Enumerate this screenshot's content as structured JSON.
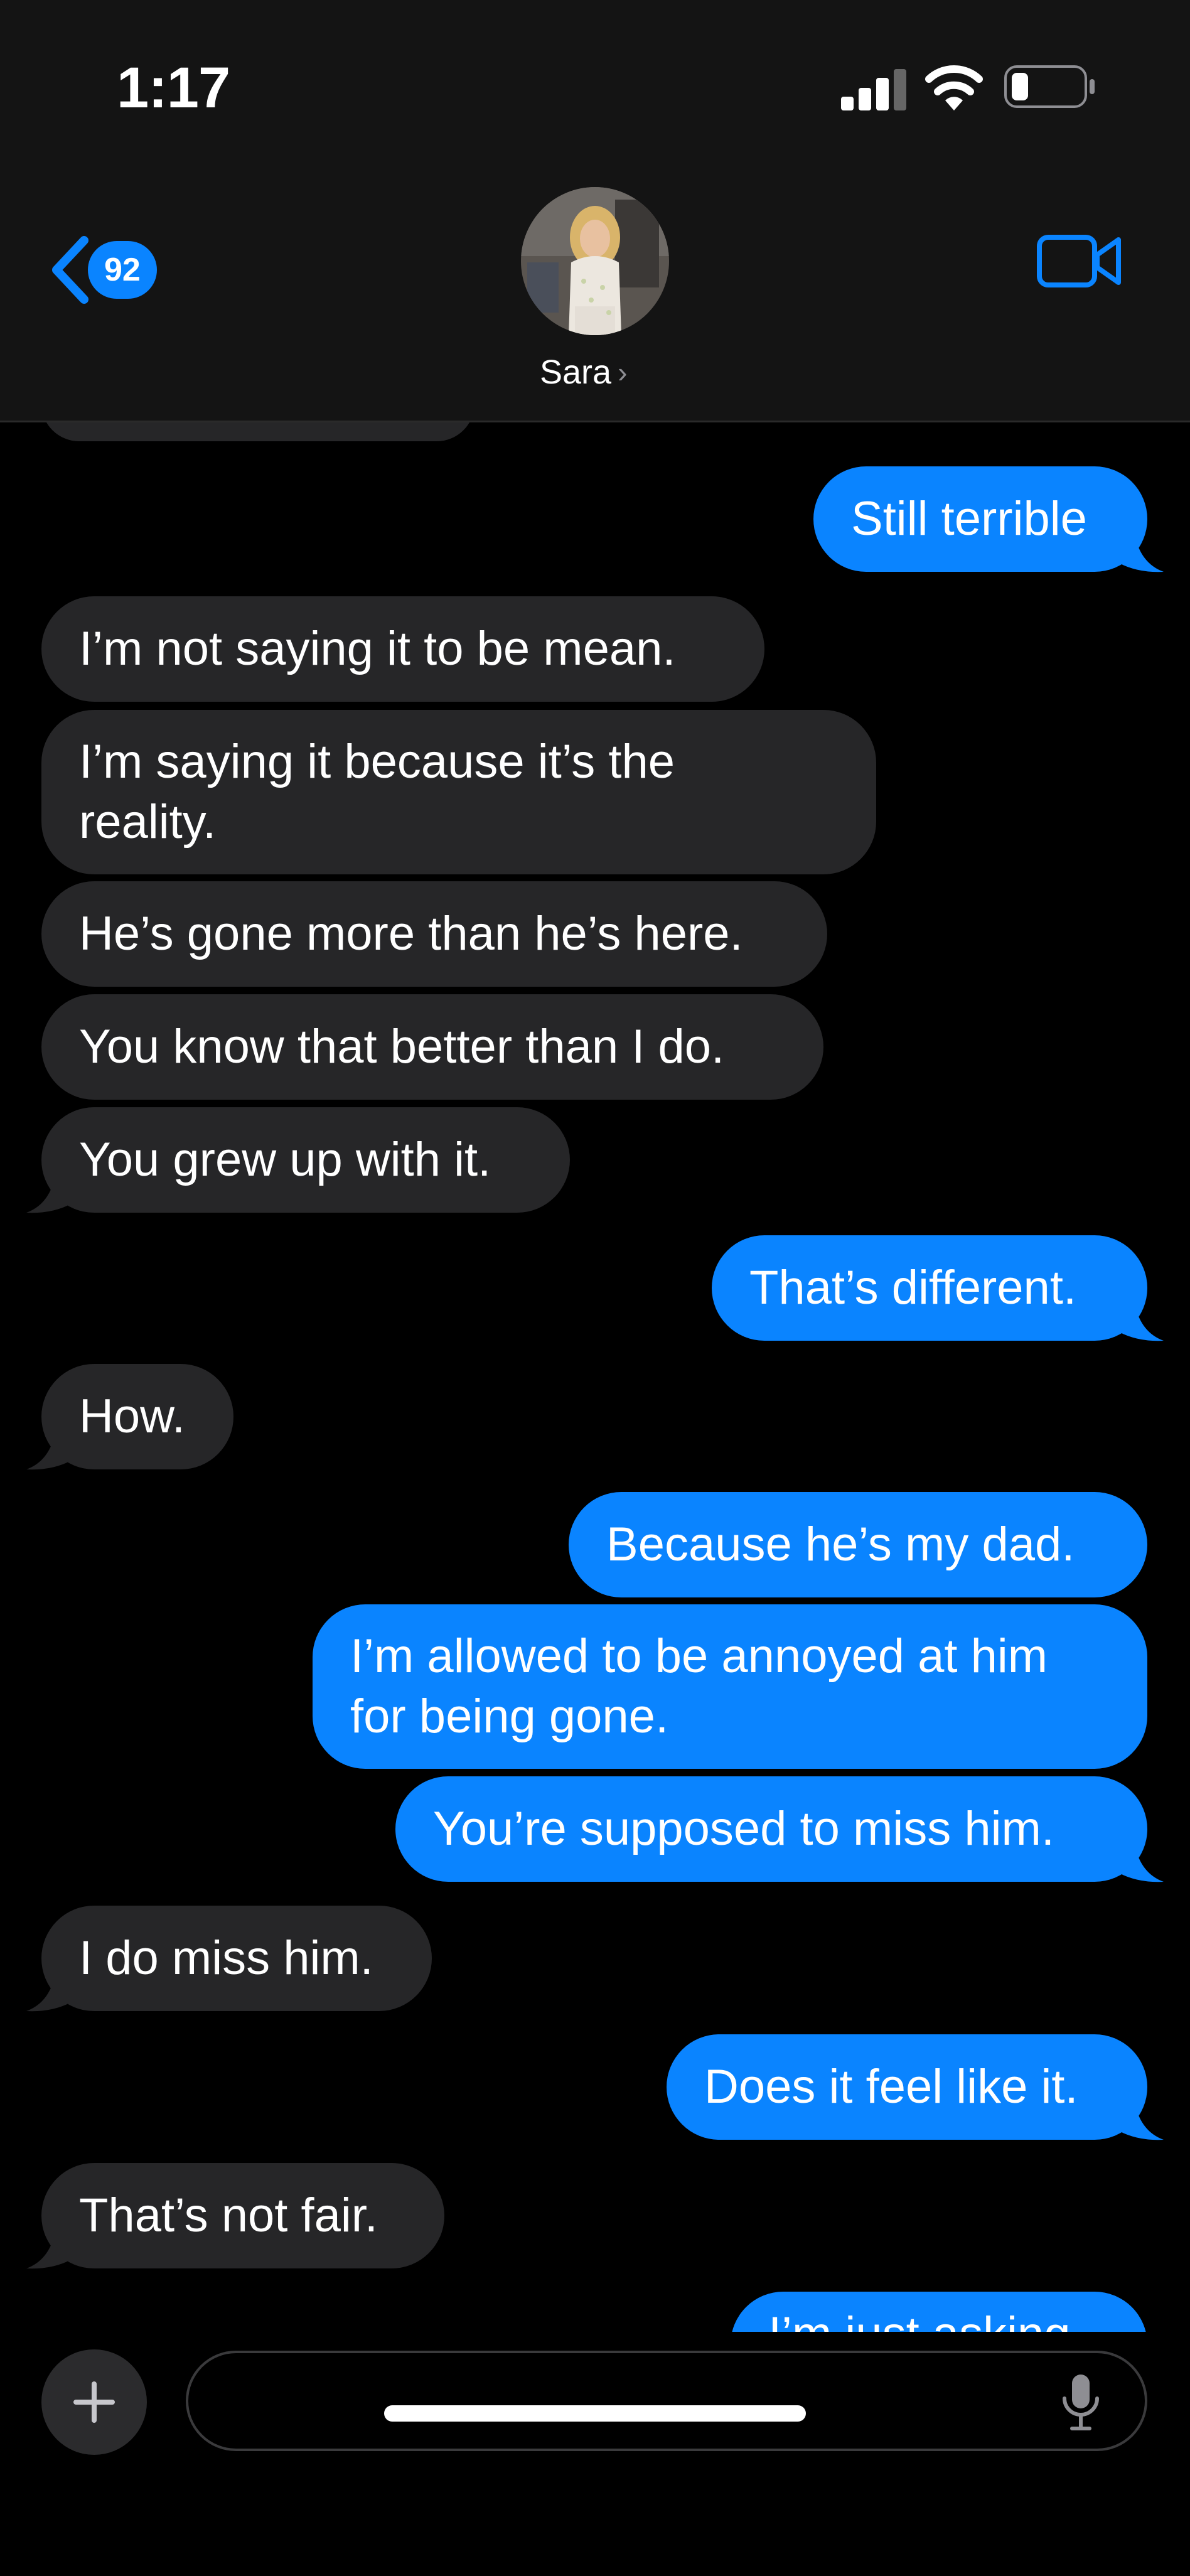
{
  "status": {
    "time": "1:17"
  },
  "header": {
    "back_count": "92",
    "contact_name": "Sara"
  },
  "icons": {
    "back": "chevron-left-icon",
    "video": "video-camera-icon",
    "mic": "microphone-icon",
    "plus": "plus-icon",
    "signal": "cellular-signal-icon",
    "wifi": "wifi-icon",
    "battery": "battery-icon"
  },
  "colors": {
    "accent": "#0a84ff",
    "incoming_bubble": "#262628",
    "header_bg": "#141414"
  },
  "messages": [
    {
      "from": "me",
      "text": "Still terrible"
    },
    {
      "from": "them",
      "text": "I’m not saying it to be mean."
    },
    {
      "from": "them",
      "text": "I’m saying it because it’s the\nreality."
    },
    {
      "from": "them",
      "text": "He’s gone more than he’s here."
    },
    {
      "from": "them",
      "text": "You know that better than I do."
    },
    {
      "from": "them",
      "text": "You grew up with it."
    },
    {
      "from": "me",
      "text": "That’s different."
    },
    {
      "from": "them",
      "text": "How."
    },
    {
      "from": "me",
      "text": "Because he’s my dad."
    },
    {
      "from": "me",
      "text": "I’m allowed to be annoyed at him\nfor being gone."
    },
    {
      "from": "me",
      "text": "You’re supposed to miss him."
    },
    {
      "from": "them",
      "text": "I do miss him."
    },
    {
      "from": "me",
      "text": "Does it feel like it."
    },
    {
      "from": "them",
      "text": "That’s not fair."
    },
    {
      "from": "me",
      "text": "I’m just asking."
    }
  ],
  "composer": {
    "placeholder": ""
  }
}
